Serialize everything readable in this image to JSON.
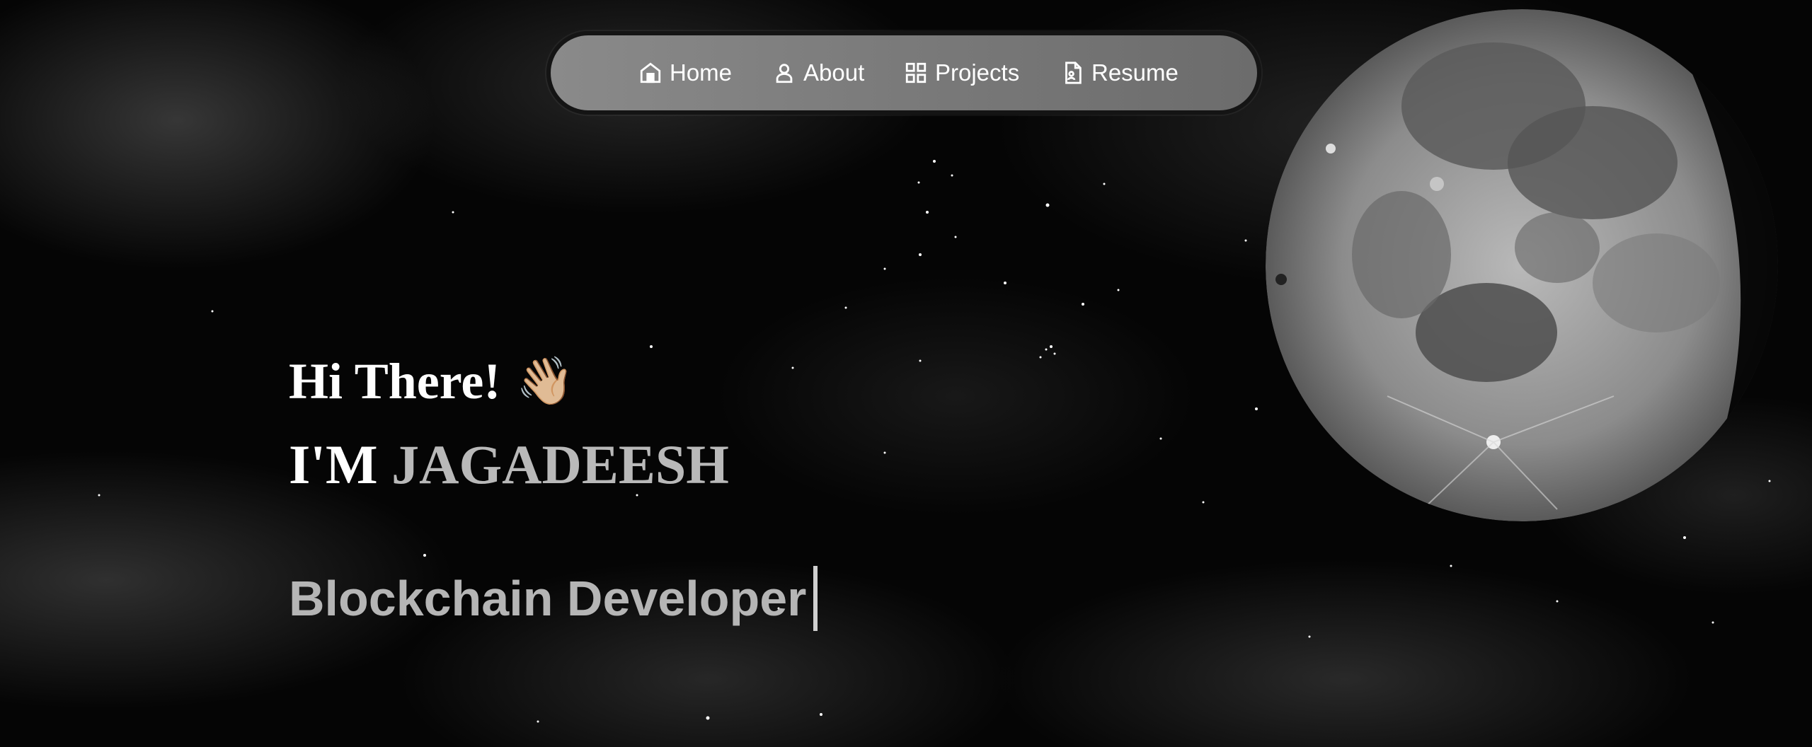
{
  "nav": {
    "items": [
      {
        "label": "Home",
        "icon": "home-icon"
      },
      {
        "label": "About",
        "icon": "user-icon"
      },
      {
        "label": "Projects",
        "icon": "grid-icon"
      },
      {
        "label": "Resume",
        "icon": "document-icon"
      }
    ]
  },
  "hero": {
    "greeting": "Hi There!",
    "wave_emoji": "👋🏼",
    "name_prefix": "I'M",
    "name": "JAGADEESH",
    "role": "Blockchain Developer"
  },
  "colors": {
    "background": "#000000",
    "nav_background": "#7a7a7a",
    "name_color": "#b9b9b9",
    "role_color": "#b5b5b5"
  }
}
